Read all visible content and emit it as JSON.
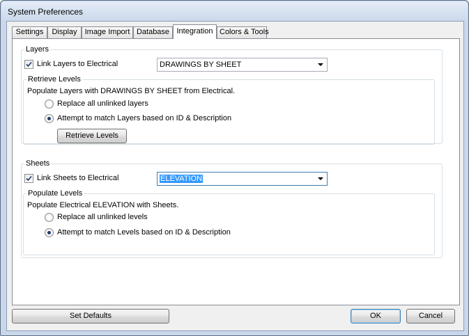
{
  "window": {
    "title": "System Preferences"
  },
  "tabs": [
    {
      "label": "Settings"
    },
    {
      "label": "Display"
    },
    {
      "label": "Image Import"
    },
    {
      "label": "Database"
    },
    {
      "label": "Integration"
    },
    {
      "label": "Colors & Tools"
    }
  ],
  "active_tab": "Integration",
  "layers": {
    "group_title": "Layers",
    "link_label": "Link Layers to Electrical",
    "link_checked": true,
    "combo_value": "DRAWINGS BY SHEET",
    "retrieve": {
      "group_title": "Retrieve Levels",
      "description": "Populate Layers with DRAWINGS BY SHEET from Electrical.",
      "option_replace": "Replace all unlinked layers",
      "option_match": "Attempt to match Layers based on ID & Description",
      "selected_option": "match",
      "button_label": "Retrieve Levels"
    }
  },
  "sheets": {
    "group_title": "Sheets",
    "link_label": "Link Sheets to Electrical",
    "link_checked": true,
    "combo_value": "ELEVATION",
    "populate": {
      "group_title": "Populate Levels",
      "description": "Populate Electrical ELEVATION with Sheets.",
      "option_replace": "Replace all unlinked levels",
      "option_match": "Attempt to match Levels based on ID & Description",
      "selected_option": "match"
    }
  },
  "footer": {
    "set_defaults_label": "Set Defaults",
    "ok_label": "OK",
    "cancel_label": "Cancel"
  }
}
